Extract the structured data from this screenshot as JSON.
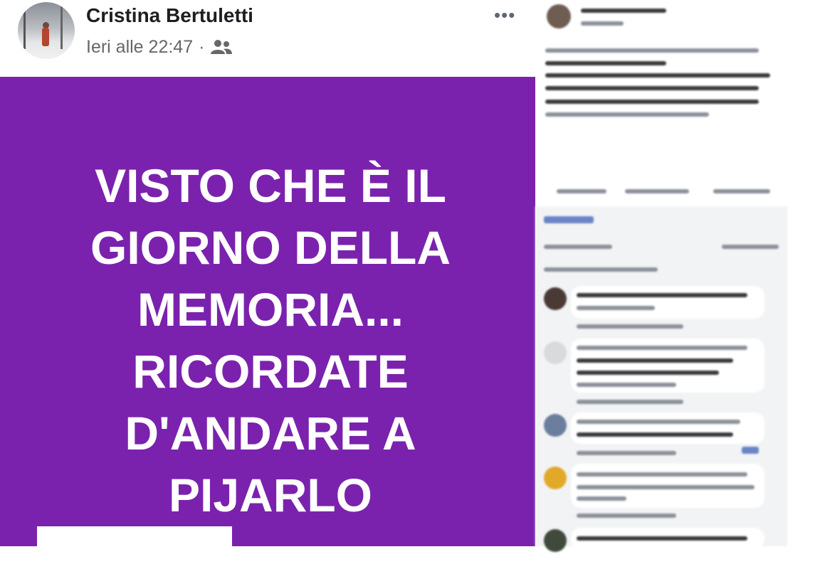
{
  "post": {
    "author": "Cristina Bertuletti",
    "time": "Ieri alle 22:47",
    "separator": "·",
    "audience_icon": "friends-icon",
    "more_icon": "more-options-icon",
    "lines": [
      "VISTO CHE È IL",
      "GIORNO DELLA",
      "MEMORIA...",
      "RICORDATE",
      "D'ANDARE A",
      "PIJARLO"
    ],
    "background_color": "#7a22ad",
    "text_color": "#ffffff"
  }
}
